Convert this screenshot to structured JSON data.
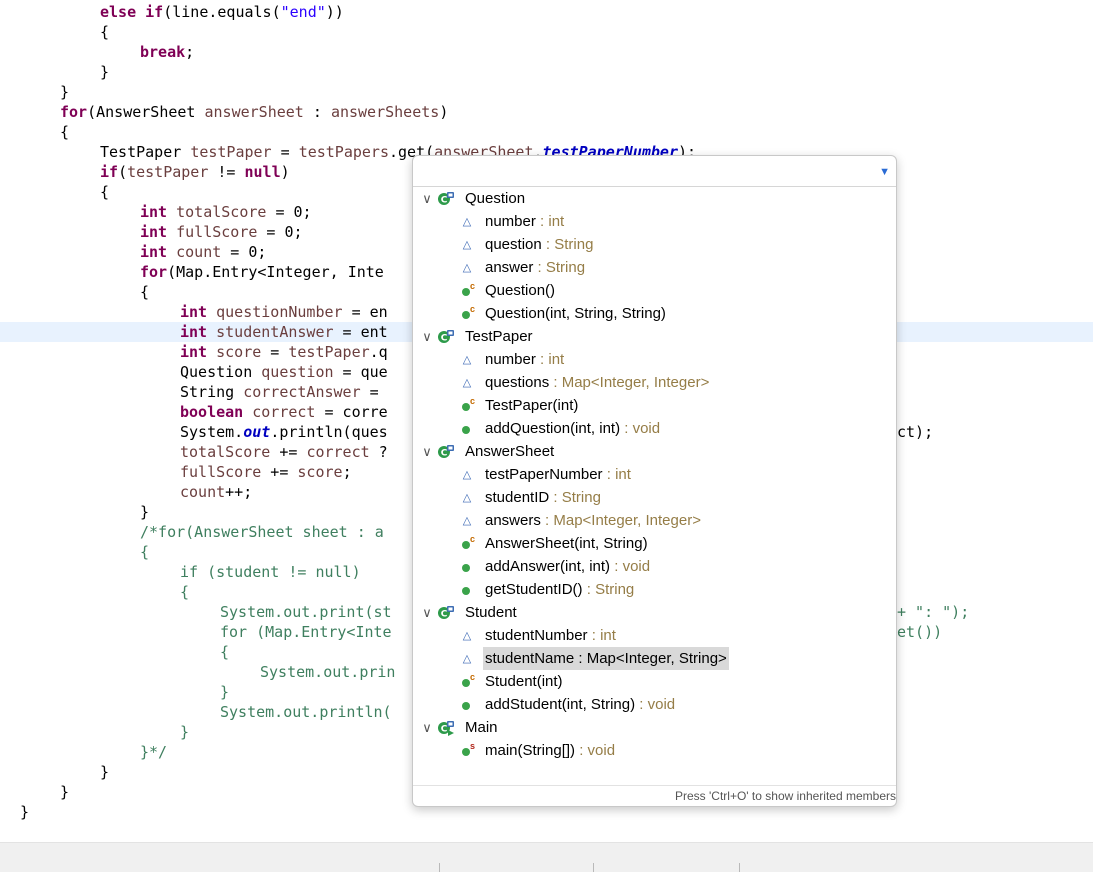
{
  "code_lines": [
    {
      "tokens": [
        {
          "t": "else",
          "c": "kw"
        },
        {
          "t": " "
        },
        {
          "t": "if",
          "c": "kw"
        },
        {
          "t": "(line.equals("
        },
        {
          "t": "\"end\"",
          "c": "str"
        },
        {
          "t": "))"
        }
      ]
    },
    {
      "tokens": [
        {
          "t": "{"
        }
      ]
    },
    {
      "tokens": [
        {
          "t": "break",
          "c": "kw"
        },
        {
          "t": ";"
        }
      ]
    },
    {
      "tokens": [
        {
          "t": "}"
        }
      ]
    },
    {
      "tokens": [
        {
          "t": "}"
        }
      ]
    },
    {
      "tokens": [
        {
          "t": "for",
          "c": "kw"
        },
        {
          "t": "(AnswerSheet "
        },
        {
          "t": "answerSheet",
          "c": "var"
        },
        {
          "t": " : "
        },
        {
          "t": "answerSheets",
          "c": "var"
        },
        {
          "t": ")"
        }
      ]
    },
    {
      "tokens": [
        {
          "t": "{"
        }
      ]
    },
    {
      "tokens": [
        {
          "t": "TestPaper "
        },
        {
          "t": "testPaper",
          "c": "var"
        },
        {
          "t": " = "
        },
        {
          "t": "testPapers",
          "c": "var"
        },
        {
          "t": ".get("
        },
        {
          "t": "answerSheet",
          "c": "var"
        },
        {
          "t": "."
        },
        {
          "t": "testPaperNumber",
          "c": "fld"
        },
        {
          "t": ");"
        }
      ]
    },
    {
      "tokens": [
        {
          "t": "if",
          "c": "kw"
        },
        {
          "t": "("
        },
        {
          "t": "testPaper",
          "c": "var"
        },
        {
          "t": " != "
        },
        {
          "t": "null",
          "c": "kw"
        },
        {
          "t": ")"
        }
      ]
    },
    {
      "tokens": [
        {
          "t": "{"
        }
      ]
    },
    {
      "tokens": [
        {
          "t": "int",
          "c": "kw"
        },
        {
          "t": " "
        },
        {
          "t": "totalScore",
          "c": "var"
        },
        {
          "t": " = 0;"
        }
      ]
    },
    {
      "tokens": [
        {
          "t": "int",
          "c": "kw"
        },
        {
          "t": " "
        },
        {
          "t": "fullScore",
          "c": "var"
        },
        {
          "t": " = 0;"
        }
      ]
    },
    {
      "tokens": [
        {
          "t": "int",
          "c": "kw"
        },
        {
          "t": " "
        },
        {
          "t": "count",
          "c": "var"
        },
        {
          "t": " = 0;"
        }
      ]
    },
    {
      "tokens": [
        {
          "t": "for",
          "c": "kw"
        },
        {
          "t": "(Map.Entry<Integer, Inte"
        }
      ]
    },
    {
      "tokens": [
        {
          "t": "{"
        }
      ]
    },
    {
      "tokens": [
        {
          "t": "int",
          "c": "kw"
        },
        {
          "t": " "
        },
        {
          "t": "questionNumber",
          "c": "var"
        },
        {
          "t": " = en"
        }
      ]
    },
    {
      "tokens": [
        {
          "t": "int",
          "c": "kw"
        },
        {
          "t": " "
        },
        {
          "t": "studentAnswer",
          "c": "var"
        },
        {
          "t": " = ent"
        }
      ]
    },
    {
      "tokens": [
        {
          "t": "int",
          "c": "kw"
        },
        {
          "t": " "
        },
        {
          "t": "score",
          "c": "var"
        },
        {
          "t": " = "
        },
        {
          "t": "testPaper",
          "c": "var"
        },
        {
          "t": ".q"
        }
      ]
    },
    {
      "tokens": [
        {
          "t": "Question "
        },
        {
          "t": "question",
          "c": "var"
        },
        {
          "t": " = que"
        }
      ]
    },
    {
      "tokens": [
        {
          "t": "String "
        },
        {
          "t": "correctAnswer",
          "c": "var"
        },
        {
          "t": " = "
        }
      ]
    },
    {
      "tokens": [
        {
          "t": "boolean",
          "c": "kw"
        },
        {
          "t": " "
        },
        {
          "t": "correct",
          "c": "var"
        },
        {
          "t": " = corre"
        }
      ]
    },
    {
      "tokens": [
        {
          "t": "System."
        },
        {
          "t": "out",
          "c": "fld"
        },
        {
          "t": ".println(ques"
        }
      ]
    },
    {
      "tokens": [
        {
          "t": "totalScore",
          "c": "var"
        },
        {
          "t": " += "
        },
        {
          "t": "correct",
          "c": "var"
        },
        {
          "t": " ?"
        }
      ]
    },
    {
      "tokens": [
        {
          "t": "fullScore",
          "c": "var"
        },
        {
          "t": " += "
        },
        {
          "t": "score",
          "c": "var"
        },
        {
          "t": ";"
        }
      ]
    },
    {
      "tokens": [
        {
          "t": "count",
          "c": "var"
        },
        {
          "t": "++;"
        }
      ]
    },
    {
      "tokens": [
        {
          "t": "}"
        }
      ]
    },
    {
      "tokens": [
        {
          "t": "/*for(AnswerSheet sheet : a",
          "c": "cmt"
        }
      ]
    },
    {
      "tokens": [
        {
          "t": "{",
          "c": "cmt"
        }
      ]
    },
    {
      "tokens": [
        {
          "t": "if (student != null)",
          "c": "cmt"
        }
      ]
    },
    {
      "tokens": [
        {
          "t": "{",
          "c": "cmt"
        }
      ]
    },
    {
      "tokens": [
        {
          "t": "System.out.print(st",
          "c": "cmt"
        }
      ]
    },
    {
      "tokens": [
        {
          "t": "for (Map.Entry<Inte",
          "c": "cmt"
        }
      ]
    },
    {
      "tokens": [
        {
          "t": "{",
          "c": "cmt"
        }
      ]
    },
    {
      "tokens": [
        {
          "t": "System.out.prin",
          "c": "cmt"
        }
      ]
    },
    {
      "tokens": [
        {
          "t": "}",
          "c": "cmt"
        }
      ]
    },
    {
      "tokens": [
        {
          "t": "System.out.println(",
          "c": "cmt"
        }
      ]
    },
    {
      "tokens": [
        {
          "t": "}",
          "c": "cmt"
        }
      ]
    },
    {
      "tokens": [
        {
          "t": "}*/",
          "c": "cmt"
        }
      ]
    },
    {
      "tokens": [
        {
          "t": "}"
        }
      ]
    },
    {
      "tokens": [
        {
          "t": "}"
        }
      ]
    },
    {
      "tokens": [
        {
          "t": "}"
        }
      ]
    }
  ],
  "code_fragments_right": [
    {
      "text": "ct);",
      "c": ""
    },
    {
      "text": "+ \": \");",
      "c": "cmt"
    },
    {
      "text": "et())",
      "c": "cmt"
    }
  ],
  "outline": {
    "filter_placeholder": "",
    "items": [
      {
        "kind": "class",
        "label": "Question",
        "type": ""
      },
      {
        "kind": "field",
        "label": "number",
        "type": " : int"
      },
      {
        "kind": "field",
        "label": "question",
        "type": " : String"
      },
      {
        "kind": "field",
        "label": "answer",
        "type": " : String"
      },
      {
        "kind": "ctor",
        "label": "Question()",
        "type": ""
      },
      {
        "kind": "ctor",
        "label": "Question(int, String, String)",
        "type": ""
      },
      {
        "kind": "class",
        "label": "TestPaper",
        "type": ""
      },
      {
        "kind": "field",
        "label": "number",
        "type": " : int"
      },
      {
        "kind": "field",
        "label": "questions",
        "type": " : Map<Integer, Integer>"
      },
      {
        "kind": "ctor",
        "label": "TestPaper(int)",
        "type": ""
      },
      {
        "kind": "method",
        "label": "addQuestion(int, int)",
        "type": " : void"
      },
      {
        "kind": "class",
        "label": "AnswerSheet",
        "type": ""
      },
      {
        "kind": "field",
        "label": "testPaperNumber",
        "type": " : int"
      },
      {
        "kind": "field",
        "label": "studentID",
        "type": " : String"
      },
      {
        "kind": "field",
        "label": "answers",
        "type": " : Map<Integer, Integer>"
      },
      {
        "kind": "ctor",
        "label": "AnswerSheet(int, String)",
        "type": ""
      },
      {
        "kind": "method",
        "label": "addAnswer(int, int)",
        "type": " : void"
      },
      {
        "kind": "method",
        "label": "getStudentID()",
        "type": " : String"
      },
      {
        "kind": "class",
        "label": "Student",
        "type": ""
      },
      {
        "kind": "field",
        "label": "studentNumber",
        "type": " : int"
      },
      {
        "kind": "field",
        "label": "studentName",
        "type": " : Map<Integer, String>",
        "selected": true
      },
      {
        "kind": "ctor",
        "label": "Student(int)",
        "type": ""
      },
      {
        "kind": "method",
        "label": "addStudent(int, String)",
        "type": " : void"
      },
      {
        "kind": "mainclass",
        "label": "Main",
        "type": ""
      },
      {
        "kind": "static",
        "label": "main(String[])",
        "type": " : void"
      }
    ],
    "footer_hint": "Press 'Ctrl+O' to show inherited members"
  },
  "colors": {
    "keyword": "#7f0055",
    "string": "#2a00ff",
    "local_var": "#6a3e3e",
    "field": "#0000c0",
    "comment": "#3f7f5f",
    "current_line": "#e8f2fe",
    "type_hint": "#957d47",
    "selection": "#d9d9d9"
  },
  "icons": {
    "class": "class-icon",
    "field": "field-icon",
    "ctor": "constructor-icon",
    "method": "method-icon",
    "static": "static-method-icon",
    "mainclass": "main-class-icon",
    "expand": "chevron-down-icon",
    "menu": "view-menu-icon"
  }
}
